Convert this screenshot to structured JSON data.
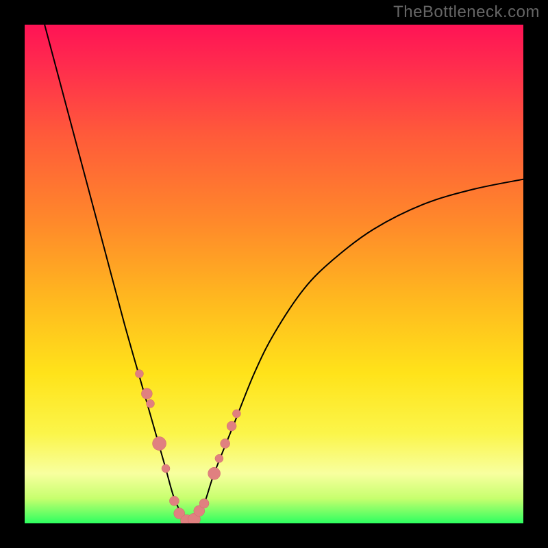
{
  "watermark": "TheBottleneck.com",
  "colors": {
    "page_bg": "#000000",
    "watermark_text": "#666666",
    "curve_stroke": "#000000",
    "dot_fill": "#e08080",
    "gradient_top": "#ff1355",
    "gradient_bottom": "#2dff60"
  },
  "chart_data": {
    "type": "line",
    "title": "",
    "xlabel": "",
    "ylabel": "",
    "xlim": [
      0,
      100
    ],
    "ylim": [
      0,
      100
    ],
    "grid": false,
    "legend": null,
    "notes": "V-shaped bottleneck curve; y is % severity (0=green/good at bottom, 100=red/bad at top). Background gradient encodes y. Minimum near x≈33. Salmon dots mark sampled points along the curve in the lower third. Values estimated from pixels.",
    "series": [
      {
        "name": "curve",
        "x": [
          4,
          8,
          12,
          16,
          20,
          24,
          28,
          30,
          32,
          33,
          34,
          36,
          38,
          42,
          46,
          50,
          56,
          62,
          70,
          80,
          90,
          100
        ],
        "y": [
          100,
          85,
          70,
          55,
          40,
          26,
          12,
          5,
          1,
          0,
          1,
          4,
          10,
          20,
          30,
          38,
          47,
          53,
          59,
          64,
          67,
          69
        ]
      }
    ],
    "markers": {
      "name": "sample-dots",
      "x": [
        23.0,
        24.5,
        25.2,
        27.0,
        28.3,
        30.0,
        31.0,
        32.5,
        34.0,
        35.0,
        36.0,
        38.0,
        39.0,
        40.2,
        41.5,
        42.5
      ],
      "y": [
        30.0,
        26.0,
        24.0,
        16.0,
        11.0,
        4.5,
        2.0,
        0.5,
        0.8,
        2.5,
        4.0,
        10.0,
        13.0,
        16.0,
        19.5,
        22.0
      ],
      "r": [
        6,
        8,
        6,
        10,
        6,
        7,
        8,
        9,
        9,
        8,
        7,
        9,
        6,
        7,
        7,
        6
      ]
    }
  }
}
